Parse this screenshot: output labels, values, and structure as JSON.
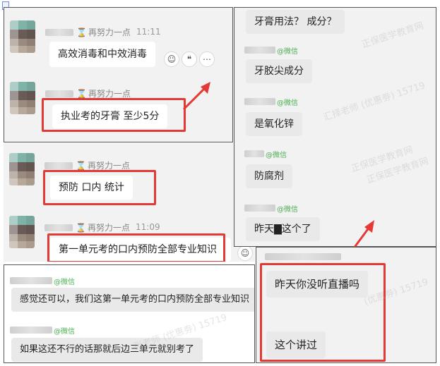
{
  "colors": {
    "highlight": "#e53935",
    "wechat_tag": "#4caf50",
    "panel_bg": "#f2f2f2",
    "bubble": "#ffffff"
  },
  "nick": "再努力一点",
  "wechat_tag": "@微信",
  "watermarks": [
    "正保医学教育网",
    "(优惠劵) 15719",
    "汇择老师 (优惠劵) 15719",
    "张老师 (优惠劵) 15719"
  ],
  "top_left": {
    "msg1": {
      "time": "11:11",
      "text": "高效消毒和中效消毒"
    },
    "msg2": {
      "text": "执业考的牙膏  至少5分"
    }
  },
  "mid_left": {
    "msg1": {
      "text": "预防 口内 统计"
    },
    "msg2": {
      "time": "11:09",
      "text": "第一单元考的口内预防全部专业知识"
    }
  },
  "bottom_left": {
    "msg1": {
      "text": "感觉还可以，我们这第一单元考的口内预防全部专业知识"
    },
    "msg2": {
      "text": "如果这还不行的话那就后边三单元就别考了"
    }
  },
  "right_top": {
    "msgs": [
      "牙膏用法？ 成分？",
      "牙胶尖成分",
      "是氧化锌",
      "防腐剂",
      "昨天▇这个了"
    ]
  },
  "right_bottom": {
    "msgs": [
      "昨天你没听直播吗",
      "这个讲过"
    ]
  }
}
